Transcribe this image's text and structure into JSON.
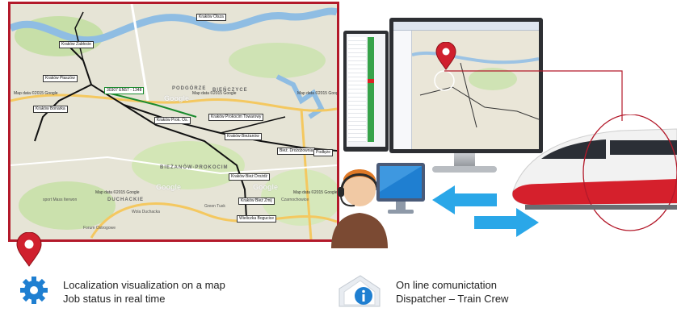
{
  "map": {
    "attribution": "Map data ©2015 Google",
    "google_mark": "Google",
    "districts": [
      "PODGÓRZE",
      "BIEŃCZYCE",
      "BIEŻANÓW-PROKOCIM",
      "DUCHACKIE"
    ],
    "stations": [
      "Kraków Zabłocie",
      "Kraków Płaszów",
      "Kraków Bonarka",
      "Kraków Prok. Os.",
      "Kraków Prokocim Towarowy",
      "Kraków Bieżanów",
      "Bież. Drożdżownia",
      "Kraków Bież Drożdż",
      "Kraków Bież Zmij",
      "Wieliczka Bogucice",
      "Kraków Olsza",
      "Podłęże"
    ],
    "train_label": "30307 EN57 - 1348",
    "places": [
      "Czarnochowice",
      "Wola Duchacka",
      "Green Tusk",
      "sport Mass Iterwon",
      "Forum Ostrogowe"
    ]
  },
  "captions": {
    "left_line1": "Localization visualization on a map",
    "left_line2": "Job status in real time",
    "right_line1": "On line comunictation",
    "right_line2": "Dispatcher – Train Crew"
  },
  "colors": {
    "accent": "#b3192a",
    "arrow": "#2aa7e8",
    "route": "#111111",
    "river": "#8fbde3"
  },
  "icons": [
    "map-pin-icon",
    "gear-icon",
    "info-envelope-icon",
    "dispatcher-headset-icon",
    "double-arrow-icon",
    "high-speed-train-icon"
  ]
}
